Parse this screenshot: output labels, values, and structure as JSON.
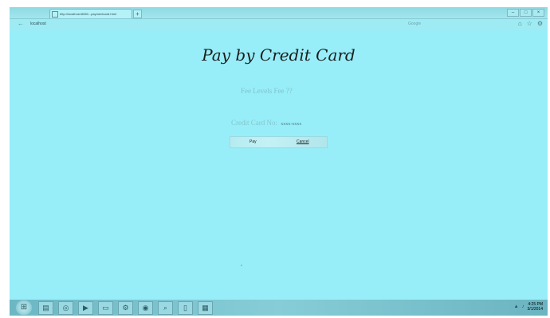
{
  "browser": {
    "tab_title": "http://localhost:8080...paymentcard.html",
    "new_tab": "+",
    "url": "localhost",
    "search_placeholder": "Google",
    "window_controls": [
      "–",
      "□",
      "×"
    ],
    "tool_icons": [
      "home-icon",
      "star-icon",
      "settings-icon"
    ]
  },
  "page": {
    "title": "Pay by Credit Card",
    "fees_label": "Fee Levels Fee ??",
    "card_label": "Credit Card No:",
    "card_value": "xxxx-xxxx",
    "pay_button": "Pay",
    "cancel_button": "Cancel"
  },
  "taskbar": {
    "start": "⊞",
    "apps": [
      "file-explorer-icon",
      "browser-icon",
      "media-icon",
      "folder-icon",
      "settings-icon",
      "chrome-icon",
      "search-icon",
      "document-icon",
      "image-icon"
    ],
    "clock_time": "4:25 PM",
    "clock_date": "3/1/2014"
  },
  "colors": {
    "screen_bg": "#97eef8",
    "title_text": "#1c1c1c"
  }
}
